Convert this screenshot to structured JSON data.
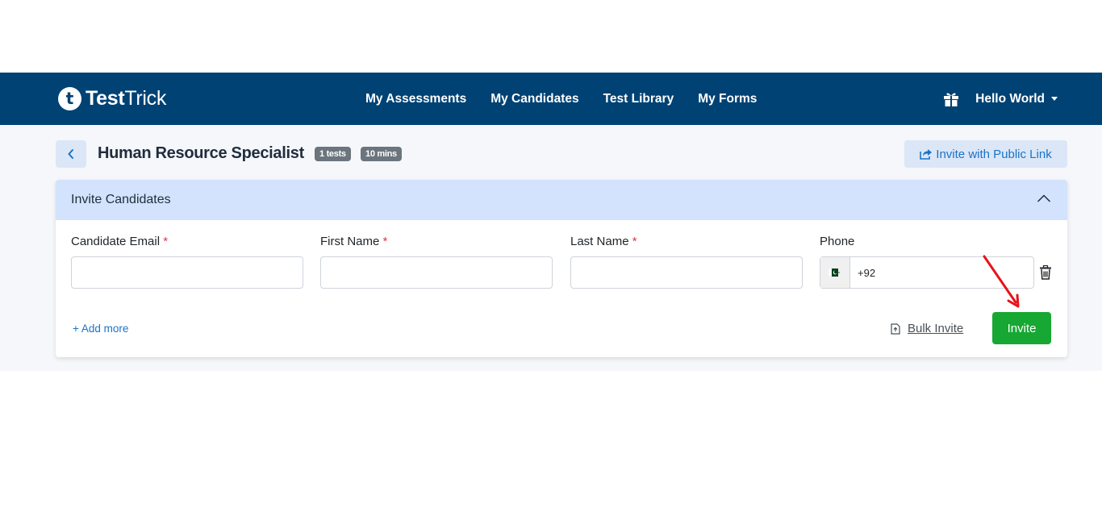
{
  "navbar": {
    "logo_letter": "t",
    "logo_bold": "Test",
    "logo_regular": "Trick",
    "links": [
      "My Assessments",
      "My Candidates",
      "Test Library",
      "My Forms"
    ],
    "user_name": "Hello World",
    "bg_color": "#004274"
  },
  "page": {
    "title": "Human Resource Specialist",
    "tests_badge": "1 tests",
    "duration_badge": "10 mins",
    "public_link_label": "Invite with Public Link"
  },
  "invite_card": {
    "header_title": "Invite Candidates",
    "fields": {
      "email_label": "Candidate Email",
      "first_name_label": "First Name",
      "last_name_label": "Last Name",
      "phone_label": "Phone",
      "required_marker": "*",
      "email_value": "",
      "first_name_value": "",
      "last_name_value": "",
      "phone_value": "+92",
      "phone_country_flag": "pk-flag-icon"
    },
    "add_more_label": "+ Add more",
    "bulk_invite_label": "Bulk Invite",
    "invite_label": "Invite",
    "invite_color": "#16a832"
  },
  "colors": {
    "accent": "#1a73c8",
    "header_bg": "#d3e3fd",
    "annotation_arrow": "#e5141b"
  }
}
